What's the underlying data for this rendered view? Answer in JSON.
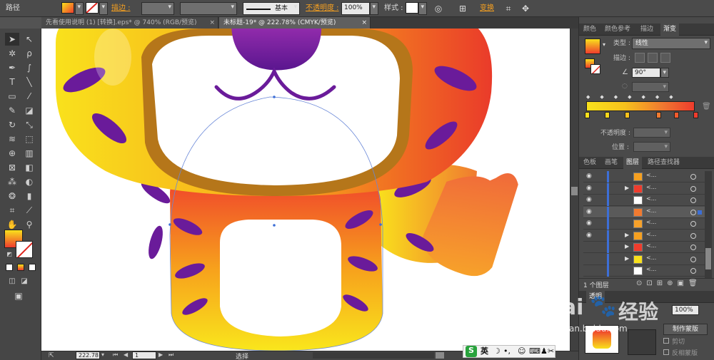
{
  "control_bar": {
    "object_type": "路径",
    "stroke_label": "描边 :",
    "stroke_profile": "基本",
    "opacity_label": "不透明度 :",
    "opacity_value": "100%",
    "style_label": "样式 :",
    "transform_label": "变换"
  },
  "doc_tabs": [
    {
      "label": "先看使用说明 (1) [转换].eps* @ 740% (RGB/预览)",
      "close": "×"
    },
    {
      "label": "未标题-19* @ 222.78% (CMYK/预览)",
      "close": "×"
    }
  ],
  "panels": {
    "top_tabs": [
      "颜色",
      "颜色参考",
      "描边",
      "渐变"
    ],
    "gradient": {
      "type_label": "类型 :",
      "type_value": "线性",
      "stroke_label": "描边 :",
      "angle_value": "90°",
      "opacity_label": "不透明度 :",
      "position_label": "位置 :"
    },
    "mid_tabs": [
      "色板",
      "画笔",
      "图层",
      "路径查找器"
    ],
    "layers": {
      "rows": 9,
      "layer_count": "1 个图层"
    },
    "bottom": {
      "tab_label": "透明",
      "opacity_value": "100%",
      "make_mask": "制作蒙版",
      "clip_label": "剪切",
      "invert_label": "反相蒙版"
    }
  },
  "status": {
    "zoom": "222.78",
    "artboard": "1",
    "tool": "选择"
  },
  "ime": {
    "logo": "S",
    "mode": "英"
  },
  "watermark": {
    "brand": "Bai",
    "brand_cn": "经验",
    "url": "jingyan.baidu.com"
  },
  "colors": {
    "accent_orange": "#f6a020",
    "tiger_purple": "#6a1b9a",
    "gradient_start": "#f9e11c",
    "gradient_end": "#ef3c2d"
  }
}
